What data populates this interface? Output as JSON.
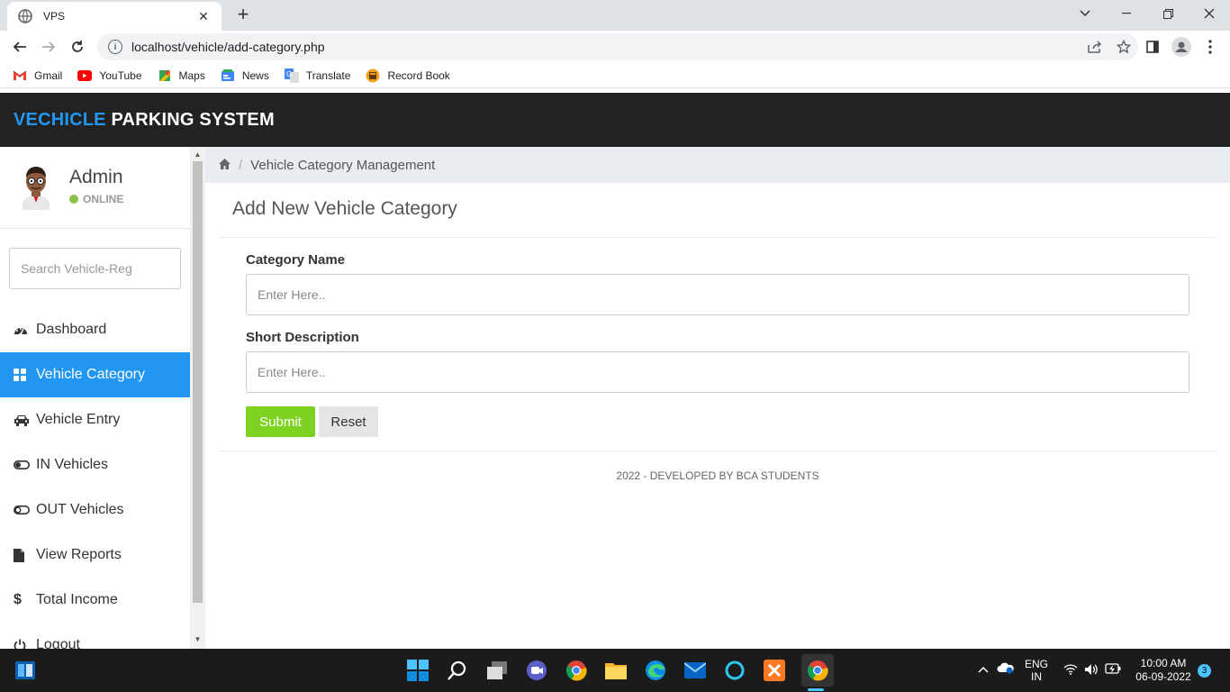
{
  "browser": {
    "tab_title": "VPS",
    "url": "localhost/vehicle/add-category.php",
    "bookmarks": [
      {
        "label": "Gmail",
        "icon": "gmail-icon"
      },
      {
        "label": "YouTube",
        "icon": "youtube-icon"
      },
      {
        "label": "Maps",
        "icon": "maps-icon"
      },
      {
        "label": "News",
        "icon": "news-icon"
      },
      {
        "label": "Translate",
        "icon": "translate-icon"
      },
      {
        "label": "Record Book",
        "icon": "record-book-icon"
      }
    ]
  },
  "header": {
    "brand_part1": "VECHICLE",
    "brand_part2": "PARKING SYSTEM",
    "accent_color": "#2196f3"
  },
  "sidebar": {
    "user_name": "Admin",
    "user_status": "ONLINE",
    "search_placeholder": "Search Vehicle-Reg",
    "items": [
      {
        "label": "Dashboard",
        "icon": "dashboard-icon",
        "active": false
      },
      {
        "label": "Vehicle Category",
        "icon": "grid-icon",
        "active": true
      },
      {
        "label": "Vehicle Entry",
        "icon": "car-icon",
        "active": false
      },
      {
        "label": "IN Vehicles",
        "icon": "toggle-on-icon",
        "active": false
      },
      {
        "label": "OUT Vehicles",
        "icon": "toggle-off-icon",
        "active": false
      },
      {
        "label": "View Reports",
        "icon": "file-icon",
        "active": false
      },
      {
        "label": "Total Income",
        "icon": "dollar-icon",
        "active": false
      },
      {
        "label": "Logout",
        "icon": "power-icon",
        "active": false
      }
    ]
  },
  "main": {
    "breadcrumb": "Vehicle Category Management",
    "title": "Add New Vehicle Category",
    "form": {
      "category_label": "Category Name",
      "category_placeholder": "Enter Here..",
      "description_label": "Short Description",
      "description_placeholder": "Enter Here..",
      "submit_label": "Submit",
      "reset_label": "Reset"
    },
    "footer": "2022 - DEVELOPED BY BCA STUDENTS"
  },
  "taskbar": {
    "lang_line1": "ENG",
    "lang_line2": "IN",
    "time": "10:00 AM",
    "date": "06-09-2022",
    "notification_count": "3"
  }
}
